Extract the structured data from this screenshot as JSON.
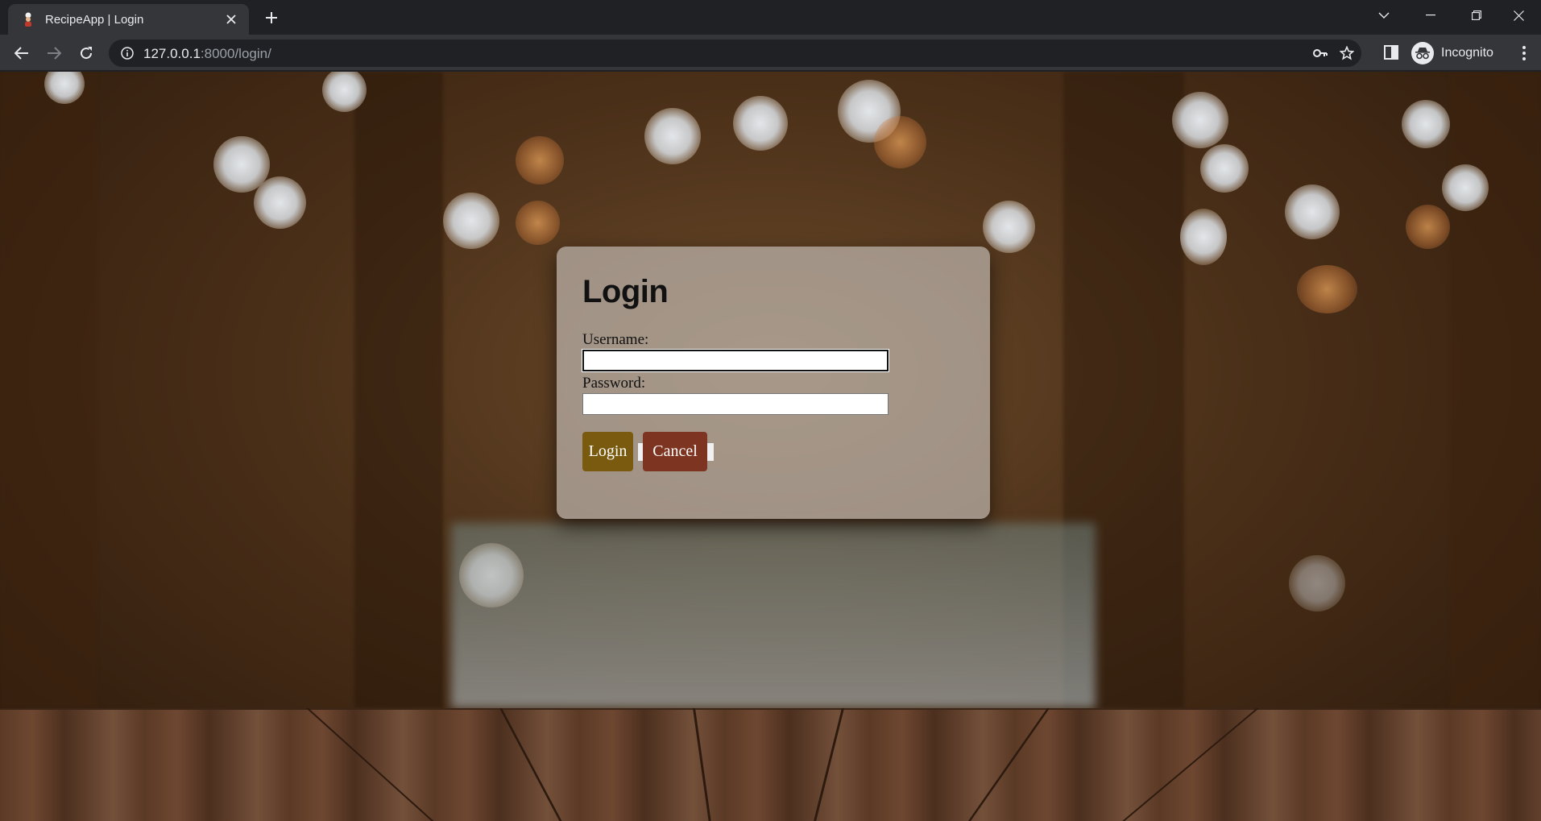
{
  "browser": {
    "tab_title": "RecipeApp | Login",
    "url_host": "127.0.0.1",
    "url_rest": ":8000/login/",
    "profile_label": "Incognito"
  },
  "login": {
    "title": "Login",
    "username_label": "Username:",
    "username_value": "",
    "password_label": "Password:",
    "password_value": "",
    "login_button": "Login",
    "cancel_button": "Cancel"
  },
  "colors": {
    "login_button": "#7a5a0f",
    "cancel_button": "#7d3420",
    "chrome_dark": "#202124",
    "chrome_toolbar": "#35363a"
  },
  "icons": [
    "chef-favicon-icon",
    "close-icon",
    "plus-icon",
    "chevron-down-icon",
    "minimize-icon",
    "restore-icon",
    "window-close-icon",
    "back-icon",
    "forward-icon",
    "reload-icon",
    "info-icon",
    "key-icon",
    "star-icon",
    "side-panel-icon",
    "incognito-icon",
    "more-menu-icon"
  ]
}
